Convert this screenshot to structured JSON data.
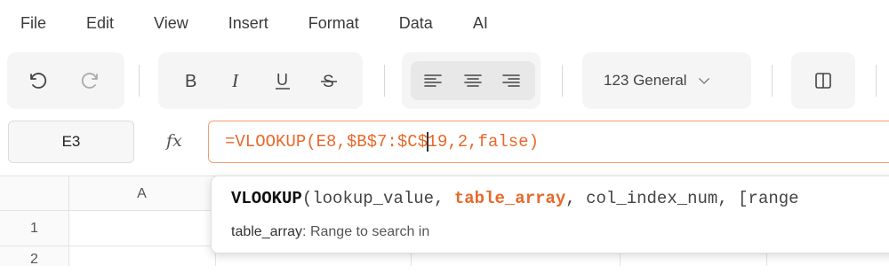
{
  "menu": [
    "File",
    "Edit",
    "View",
    "Insert",
    "Format",
    "Data",
    "AI"
  ],
  "toolbar": {
    "number_format": "123 General",
    "icons": [
      "undo-icon",
      "redo-icon",
      "bold-icon",
      "italic-icon",
      "underline-icon",
      "strikethrough-icon",
      "align-left-icon",
      "align-center-icon",
      "align-right-icon",
      "chevron-down-icon",
      "columns-icon"
    ]
  },
  "formula_bar": {
    "cell_ref": "E3",
    "fx": "fx",
    "formula_before_caret": "=VLOOKUP(E8,$B$7:$C$",
    "formula_after_caret": "19,2,false)"
  },
  "grid": {
    "columns": [
      "A"
    ],
    "rows": [
      "1",
      "2"
    ]
  },
  "autocomplete": {
    "function_name": "VLOOKUP",
    "open_paren": "(",
    "arg1": "lookup_value",
    "sep": ", ",
    "arg2_active": "table_array",
    "arg3": "col_index_num",
    "arg4": "[range",
    "param_name": "table_array",
    "param_desc": ": Range to search in"
  },
  "colors": {
    "accent": "#e8692a",
    "formula_border": "#f0a070"
  }
}
